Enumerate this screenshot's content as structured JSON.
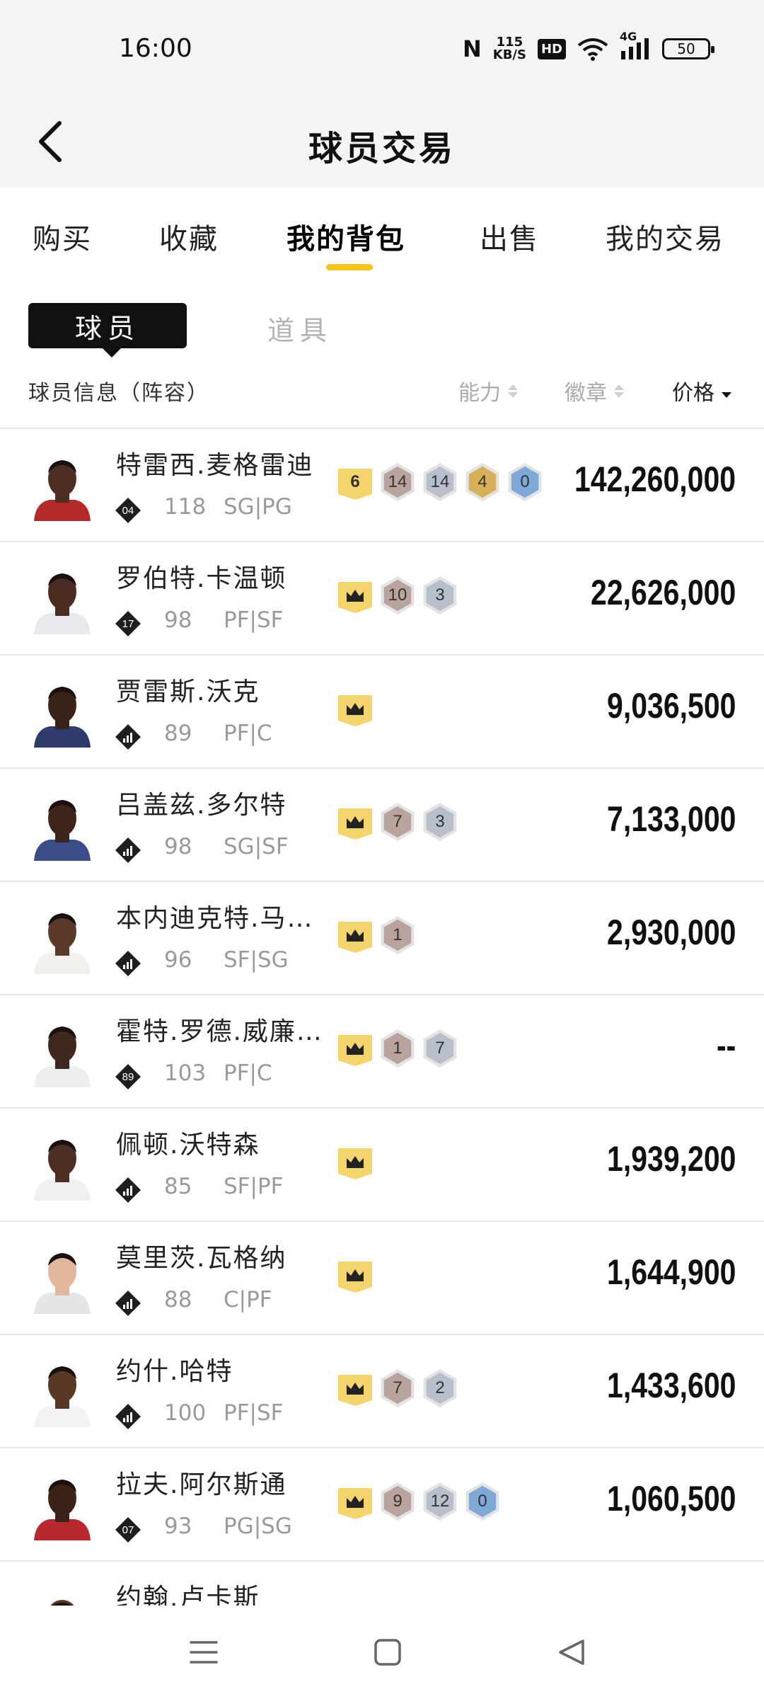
{
  "status": {
    "time": "16:00",
    "nfc": "N",
    "speed_value": "115",
    "speed_unit": "KB/S",
    "hd": "HD",
    "network": "4G",
    "battery": "50"
  },
  "header": {
    "title": "球员交易"
  },
  "tabs": [
    {
      "label": "购买",
      "active": false
    },
    {
      "label": "收藏",
      "active": false
    },
    {
      "label": "我的背包",
      "active": true
    },
    {
      "label": "出售",
      "active": false
    },
    {
      "label": "我的交易",
      "active": false
    }
  ],
  "subtabs": {
    "active": "球员",
    "inactive": "道具"
  },
  "list_header": {
    "info": "球员信息（阵容）",
    "ability": "能力",
    "badge": "徽章",
    "price": "价格"
  },
  "colors": {
    "accent": "#f5c518",
    "gold_badge": "#f6d46c",
    "bronze_badge": "#b8a49c",
    "silver_badge": "#b7bfcc",
    "hof_badge": "#d7b15a",
    "blue_badge": "#7ea9d6"
  },
  "players": [
    {
      "name": "特雷西.麦格雷迪",
      "tier": "04",
      "rating": "118",
      "position": "SG|PG",
      "jersey": "#b52a2a",
      "skin": "#4e2e22",
      "price": "142,260,000",
      "badges": [
        {
          "type": "gold",
          "value": "6"
        },
        {
          "type": "bronze",
          "value": "14"
        },
        {
          "type": "silver",
          "value": "14"
        },
        {
          "type": "hof",
          "value": "4"
        },
        {
          "type": "blue",
          "value": "0"
        }
      ]
    },
    {
      "name": "罗伯特.卡温顿",
      "tier": "17",
      "rating": "98",
      "position": "PF|SF",
      "jersey": "#e8e8ee",
      "skin": "#4a2c20",
      "price": "22,626,000",
      "badges": [
        {
          "type": "crown",
          "value": ""
        },
        {
          "type": "bronze",
          "value": "10"
        },
        {
          "type": "silver",
          "value": "3"
        }
      ]
    },
    {
      "name": "贾雷斯.沃克",
      "tier": "",
      "rating": "89",
      "position": "PF|C",
      "jersey": "#2f3b6a",
      "skin": "#3a241a",
      "price": "9,036,500",
      "badges": [
        {
          "type": "crown",
          "value": ""
        }
      ]
    },
    {
      "name": "吕盖兹.多尔特",
      "tier": "",
      "rating": "98",
      "position": "SG|SF",
      "jersey": "#3b4c8a",
      "skin": "#3d251b",
      "price": "7,133,000",
      "badges": [
        {
          "type": "crown",
          "value": ""
        },
        {
          "type": "bronze",
          "value": "7"
        },
        {
          "type": "silver",
          "value": "3"
        }
      ]
    },
    {
      "name": "本内迪克特.马…",
      "tier": "",
      "rating": "96",
      "position": "SF|SG",
      "jersey": "#f2f0ea",
      "skin": "#5b3a29",
      "price": "2,930,000",
      "badges": [
        {
          "type": "crown",
          "value": ""
        },
        {
          "type": "bronze",
          "value": "1"
        }
      ]
    },
    {
      "name": "霍特.罗德.威廉…",
      "tier": "89",
      "rating": "103",
      "position": "PF|C",
      "jersey": "#eeeeee",
      "skin": "#3f281d",
      "price": "--",
      "badges": [
        {
          "type": "crown",
          "value": ""
        },
        {
          "type": "bronze",
          "value": "1"
        },
        {
          "type": "silver",
          "value": "7"
        }
      ]
    },
    {
      "name": "佩顿.沃特森",
      "tier": "",
      "rating": "85",
      "position": "SF|PF",
      "jersey": "#f0f0f0",
      "skin": "#4c2f22",
      "price": "1,939,200",
      "badges": [
        {
          "type": "crown",
          "value": ""
        }
      ]
    },
    {
      "name": "莫里茨.瓦格纳",
      "tier": "",
      "rating": "88",
      "position": "C|PF",
      "jersey": "#e6e6e6",
      "skin": "#e2b89c",
      "price": "1,644,900",
      "badges": [
        {
          "type": "crown",
          "value": ""
        }
      ]
    },
    {
      "name": "约什.哈特",
      "tier": "",
      "rating": "100",
      "position": "PF|SF",
      "jersey": "#f3f3f3",
      "skin": "#5a3826",
      "price": "1,433,600",
      "badges": [
        {
          "type": "crown",
          "value": ""
        },
        {
          "type": "bronze",
          "value": "7"
        },
        {
          "type": "silver",
          "value": "2"
        }
      ]
    },
    {
      "name": "拉夫.阿尔斯通",
      "tier": "07",
      "rating": "93",
      "position": "PG|SG",
      "jersey": "#b8292f",
      "skin": "#3b2319",
      "price": "1,060,500",
      "badges": [
        {
          "type": "crown",
          "value": ""
        },
        {
          "type": "bronze",
          "value": "9"
        },
        {
          "type": "silver",
          "value": "12"
        },
        {
          "type": "blue",
          "value": "0"
        }
      ]
    }
  ],
  "partial_player": {
    "name": "约翰.卢卡斯"
  }
}
